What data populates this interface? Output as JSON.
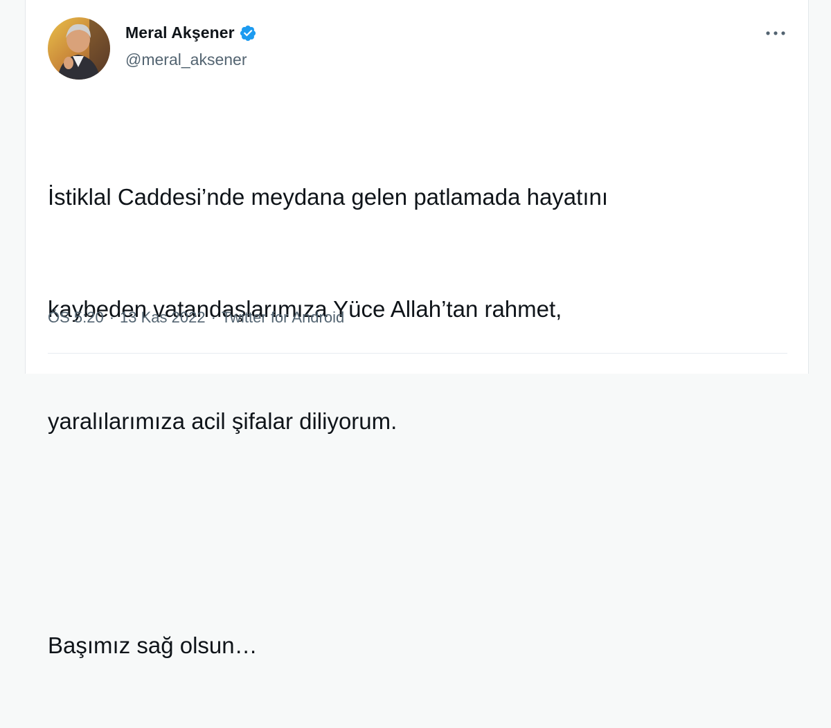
{
  "author": {
    "name": "Meral Akşener",
    "handle": "@meral_aksener",
    "verified": true,
    "verified_color": "#1d9bf0"
  },
  "tweet": {
    "lines": [
      "İstiklal Caddesi’nde meydana gelen patlamada hayatını",
      "kaybeden vatandaşlarımıza Yüce Allah’tan rahmet,",
      "yaralılarımıza acil şifalar diliyorum.",
      "",
      "Başımız sağ olsun…"
    ]
  },
  "meta": {
    "time": "ÖS 5:20",
    "separator": "·",
    "date": "13 Kas 2022",
    "source": "Twitter for Android"
  },
  "icons": {
    "more": "more-options-icon",
    "verified": "verified-badge-icon"
  }
}
